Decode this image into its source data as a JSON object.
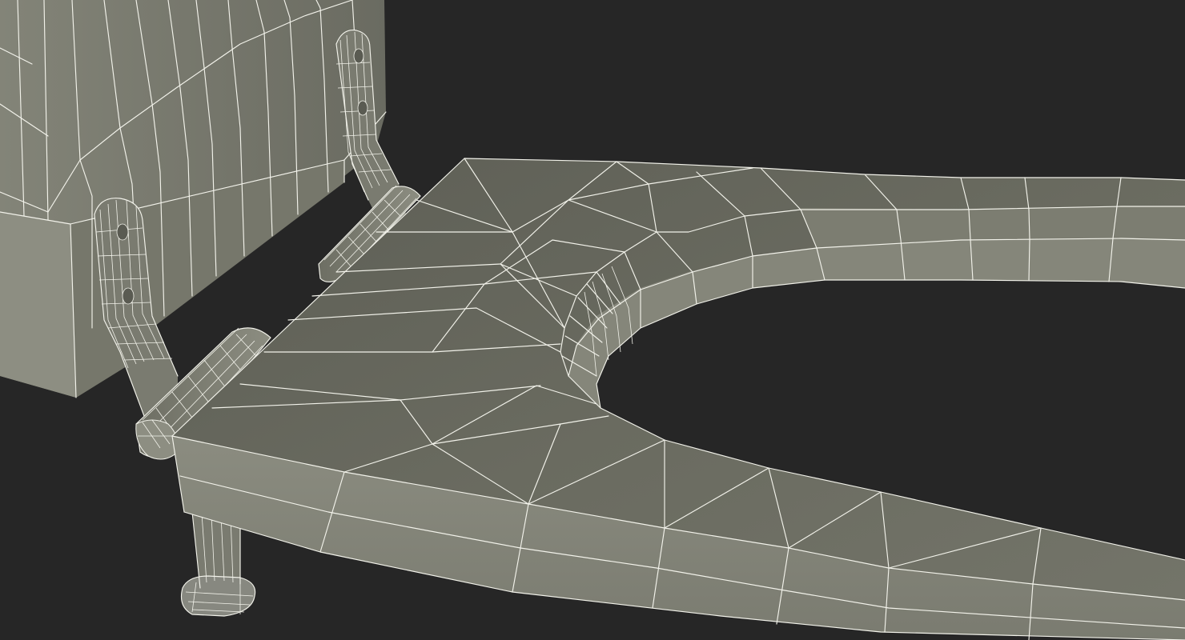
{
  "scene": {
    "subject": "toilet-seat-wireframe-render",
    "colors": {
      "background": "#262626",
      "surface_light": "#8a8b7e",
      "surface_mid": "#6f7064",
      "surface_dark": "#55564d",
      "wire": "#f2f2ea"
    },
    "objects": [
      {
        "name": "tank-lid-panel",
        "shading": "flat-gray"
      },
      {
        "name": "hinge-bracket-left",
        "shading": "flat-gray"
      },
      {
        "name": "hinge-bracket-right",
        "shading": "flat-gray"
      },
      {
        "name": "hinge-barrel-left",
        "shading": "flat-gray"
      },
      {
        "name": "hinge-barrel-right",
        "shading": "flat-gray"
      },
      {
        "name": "seat-ring",
        "shading": "flat-gray"
      },
      {
        "name": "seat-bumper-foot",
        "shading": "flat-gray"
      }
    ]
  }
}
